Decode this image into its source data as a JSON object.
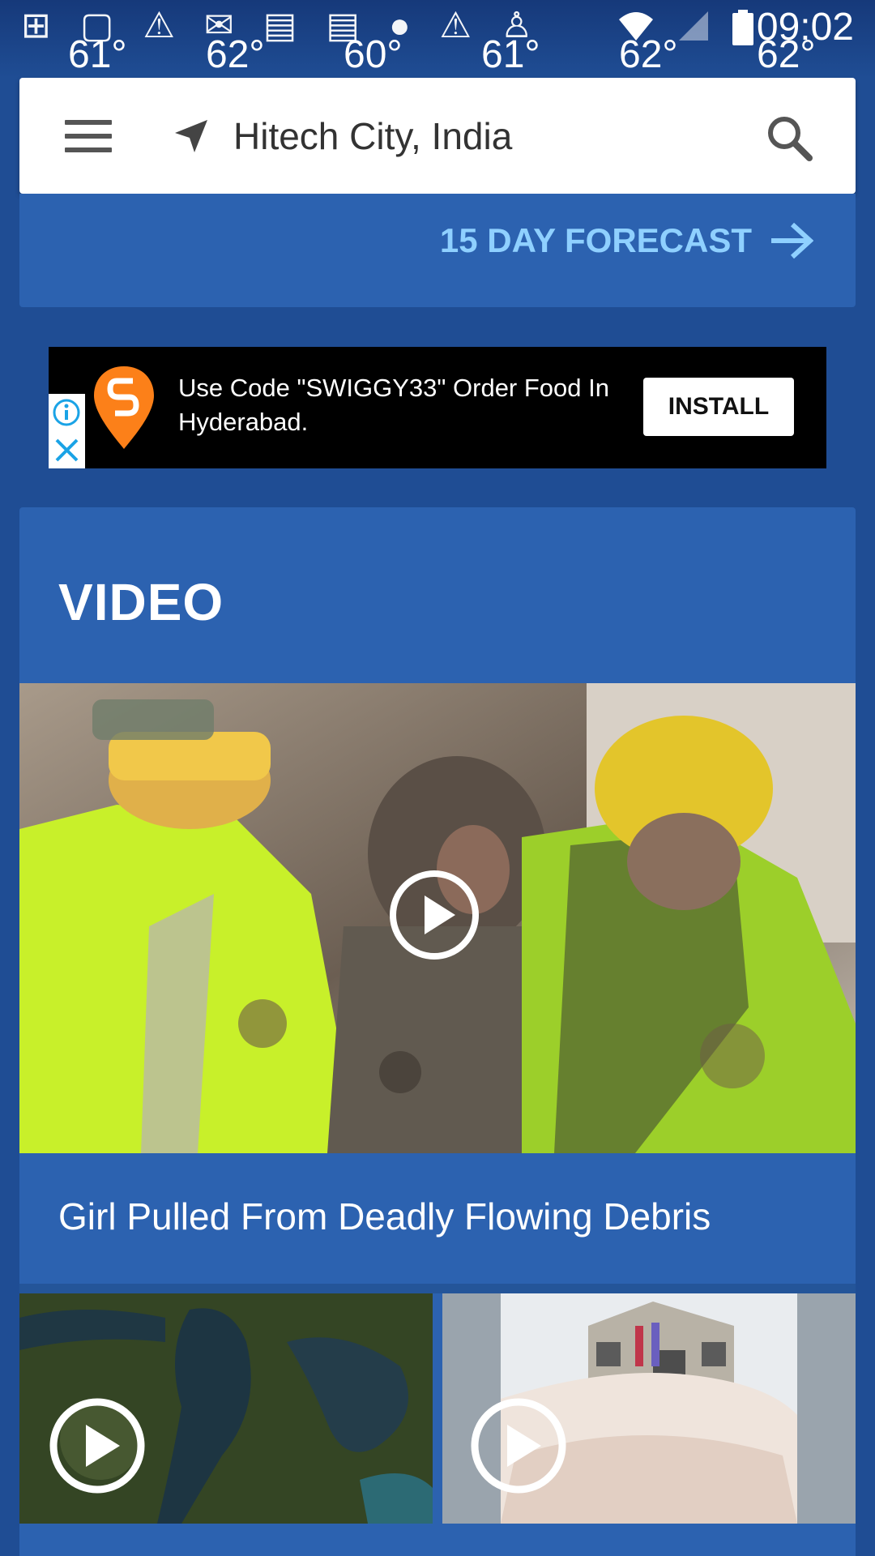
{
  "status_bar": {
    "time": "09:02",
    "temperatures": [
      "61°",
      "62°",
      "60°",
      "61°",
      "62°",
      "62°"
    ],
    "left_icons": [
      "add-icon",
      "tablet-icon",
      "warning-icon",
      "gmail-icon",
      "message-icon",
      "message-icon",
      "chat-icon",
      "warning-icon",
      "running-icon"
    ],
    "right_icons": [
      "wifi-icon",
      "signal-icon",
      "battery-icon"
    ]
  },
  "location_bar": {
    "location": "Hitech City, India"
  },
  "forecast": {
    "link_label": "15 DAY FORECAST",
    "accent": "#8fd0ff"
  },
  "ad": {
    "text": "Use Code \"SWIGGY33\" Order Food In Hyderabad.",
    "install_label": "INSTALL",
    "brand_color": "#fc8019"
  },
  "video": {
    "heading": "VIDEO",
    "main_title": "Girl Pulled From Deadly Flowing Debris"
  },
  "colors": {
    "background": "#1f4d94",
    "card": "#2c62b0",
    "white": "#ffffff"
  }
}
